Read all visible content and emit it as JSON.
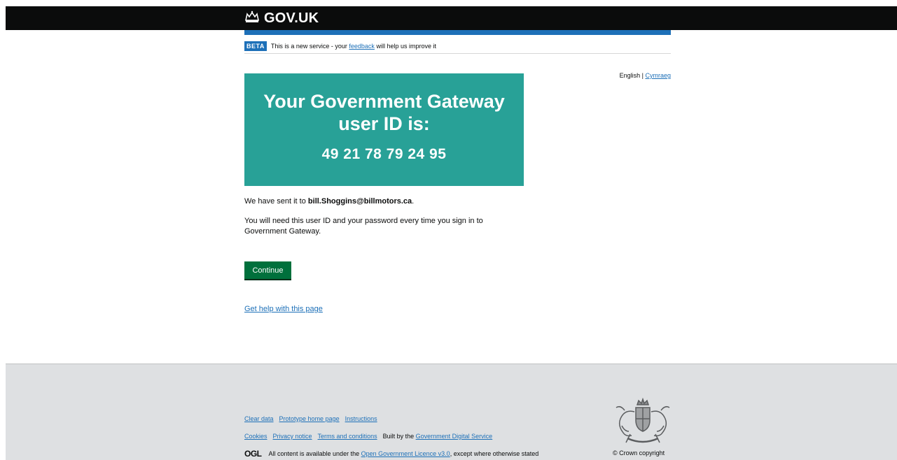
{
  "header": {
    "logo_text": "GOV.UK",
    "brand_color": "#1d70b8"
  },
  "banner": {
    "tag": "BETA",
    "text_before": "This is a new service - your",
    "link": "feedback",
    "text_after": "will help us improve it"
  },
  "language": {
    "current": "English",
    "separator": "|",
    "other": "Cymraeg"
  },
  "panel": {
    "title": "Your Government Gateway user ID is:",
    "user_id": "49 21 78 79 24 95",
    "color": "#28a197"
  },
  "body": {
    "sent_prefix": "We have sent it to",
    "email": "bill.Shoggins@billmotors.ca",
    "sent_suffix": ".",
    "note": "You will need this user ID and your password every time you sign in to Government Gateway."
  },
  "actions": {
    "continue_label": "Continue",
    "button_color": "#00703c",
    "help_link": "Get help with this page"
  },
  "footer": {
    "links_row1": [
      "Clear data",
      "Prototype home page",
      "Instructions"
    ],
    "links_row2": [
      "Cookies",
      "Privacy notice",
      "Terms and conditions"
    ],
    "built_by_prefix": "Built by the",
    "built_by_link": "Government Digital Service",
    "ogl_logo": "OGL",
    "licence_prefix": "All content is available under the",
    "licence_link": "Open Government Licence v3.0",
    "licence_suffix": ", except where otherwise stated",
    "copyright": "© Crown copyright",
    "crest_icon": "royal-coat-of-arms-icon"
  }
}
